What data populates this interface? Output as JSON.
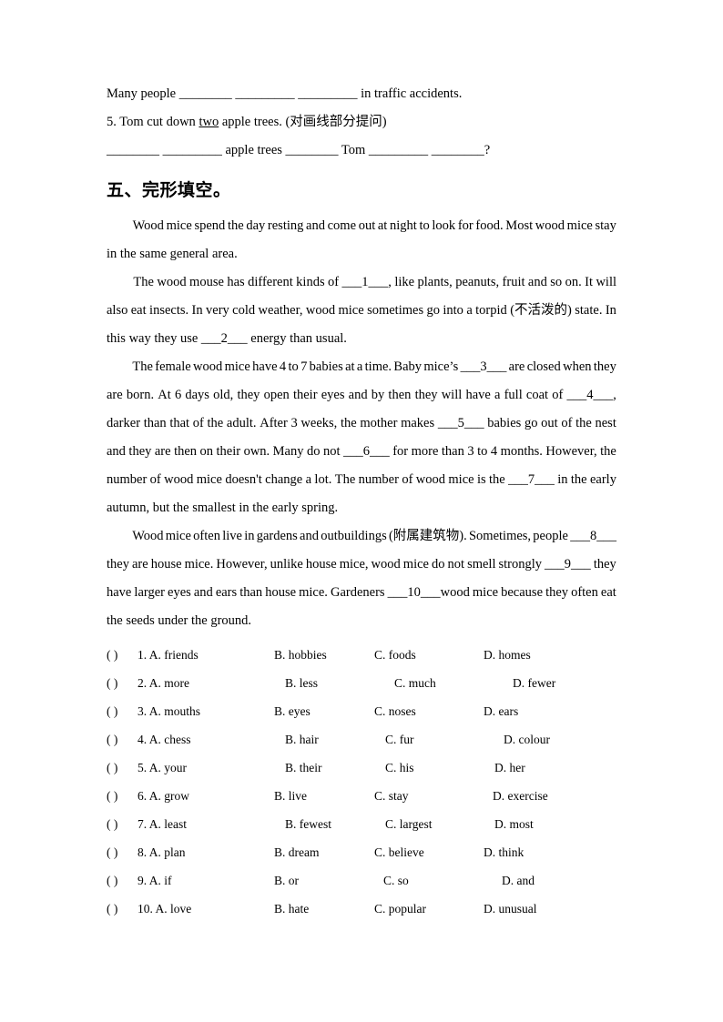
{
  "top_section": {
    "line1": "Many people ________ _________ _________ in traffic accidents.",
    "line2_prefix": "5. Tom cut down ",
    "line2_underlined": "two",
    "line2_suffix": " apple trees. (对画线部分提问)",
    "line3": "________ _________ apple trees ________ Tom _________ ________?"
  },
  "section": {
    "heading": "五、完形填空。"
  },
  "passage": {
    "p1": [
      {
        "text": "Wood mice spend the day resting and come out at night to look for food. Most wood mice stay",
        "justify": true,
        "indent": true
      },
      {
        "text": "in the same general area.",
        "justify": false,
        "indent": false
      }
    ],
    "p2": [
      {
        "text": "The wood mouse has different kinds of ___1___, like plants, peanuts, fruit and so on. It will",
        "justify": true,
        "indent": true
      },
      {
        "text": "also eat insects. In very cold weather, wood mice sometimes go into a torpid (不活泼的) state. In",
        "justify": true,
        "indent": false
      },
      {
        "text": "this way they use ___2___ energy than usual.",
        "justify": false,
        "indent": false
      }
    ],
    "p3": [
      {
        "text": "The female wood mice have 4 to 7 babies at a time. Baby mice’s ___3___ are closed when they",
        "justify": true,
        "indent": true
      },
      {
        "text": "are born. At 6 days old, they open their eyes and by then they will have a full coat of ___4___,",
        "justify": true,
        "indent": false
      },
      {
        "text": "darker than that of the adult. After 3 weeks, the mother makes ___5___ babies go out of the nest",
        "justify": true,
        "indent": false
      },
      {
        "text": "and they are then on their own. Many do not ___6___ for more than 3 to 4 months. However, the",
        "justify": true,
        "indent": false
      },
      {
        "text": "number of wood mice doesn't change a lot. The number of wood mice is the ___7___ in the early",
        "justify": true,
        "indent": false
      },
      {
        "text": "autumn, but the smallest in the early spring.",
        "justify": false,
        "indent": false
      }
    ],
    "p4": [
      {
        "text": "Wood mice often live in gardens and outbuildings (附属建筑物). Sometimes, people ___8___",
        "justify": true,
        "indent": true
      },
      {
        "text": "they are house mice. However, unlike house mice, wood mice do not smell strongly ___9___ they",
        "justify": true,
        "indent": false
      },
      {
        "text": "have larger eyes and ears than house mice. Gardeners ___10___wood mice because they often eat",
        "justify": true,
        "indent": false
      },
      {
        "text": "the seeds under the ground.",
        "justify": false,
        "indent": false
      }
    ]
  },
  "options": {
    "paren": "(      )",
    "rows": [
      {
        "num": "1.",
        "a": "A. friends",
        "b": "B. hobbies",
        "c": "C. foods",
        "d": "D. homes",
        "b_ind": 0,
        "c_ind": 0,
        "d_ind": 0
      },
      {
        "num": "2.",
        "a": "A. more",
        "b": "B. less",
        "c": "C. much",
        "d": "D. fewer",
        "b_ind": 1,
        "c_ind": 1,
        "d_ind": 1
      },
      {
        "num": "3.",
        "a": "A. mouths",
        "b": "B. eyes",
        "c": "C. noses",
        "d": "D. ears",
        "b_ind": 0,
        "c_ind": 0,
        "d_ind": 0
      },
      {
        "num": "4.",
        "a": "A. chess",
        "b": "B. hair",
        "c": "C. fur",
        "d": "D. colour",
        "b_ind": 1,
        "c_ind": 0,
        "d_ind": 1
      },
      {
        "num": "5.",
        "a": "A. your",
        "b": "B. their",
        "c": "C. his",
        "d": "D. her",
        "b_ind": 1,
        "c_ind": 0,
        "d_ind": 0
      },
      {
        "num": "6.",
        "a": "A. grow",
        "b": "B. live",
        "c": "C. stay",
        "d": "D. exercise",
        "b_ind": 0,
        "c_ind": 0,
        "d_ind": 1
      },
      {
        "num": "7.",
        "a": "A. least",
        "b": "B. fewest",
        "c": "C. largest",
        "d": "D. most",
        "b_ind": 1,
        "c_ind": 0,
        "d_ind": 0
      },
      {
        "num": "8.",
        "a": "A. plan",
        "b": "B. dream",
        "c": "C. believe",
        "d": "D. think",
        "b_ind": 0,
        "c_ind": 0,
        "d_ind": 0
      },
      {
        "num": "9.",
        "a": "A. if",
        "b": "B. or",
        "c": "C. so",
        "d": "D. and",
        "b_ind": 0,
        "c_ind": 1,
        "d_ind": 1
      },
      {
        "num": "10.",
        "a": "A. love",
        "b": "B. hate",
        "c": "C. popular",
        "d": "D. unusual",
        "b_ind": 0,
        "c_ind": 0,
        "d_ind": 0
      }
    ]
  }
}
